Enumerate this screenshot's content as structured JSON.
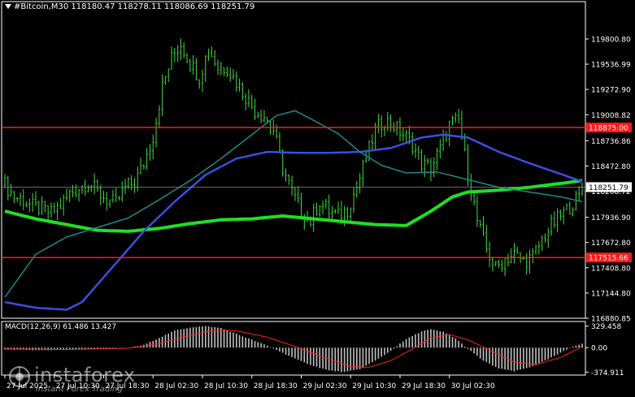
{
  "header": {
    "symbol_tf": "#Bitcoin,M30",
    "ohlc": "118180.47 118278.11 118086.69 118251.79"
  },
  "watermark": {
    "brand": "instaforex",
    "tagline": "Instant Forex Trading"
  },
  "chart_data": [
    {
      "type": "candlestick",
      "title": "#Bitcoin,M30",
      "ylim": [
        116880.85,
        120072
      ],
      "y_ticks": [
        119800.8,
        119536.99,
        119272.9,
        119008.82,
        118736.86,
        118472.8,
        118208.72,
        117936.9,
        117672.8,
        117408.8,
        117144.8,
        116880.85
      ],
      "x_ticks": [
        "27 Jul 2025",
        "27 Jul 10:30",
        "27 Jul 18:30",
        "28 Jul 02:30",
        "28 Jul 10:30",
        "28 Jul 18:30",
        "29 Jul 02:30",
        "29 Jul 10:30",
        "29 Jul 18:30",
        "30 Jul 02:30"
      ],
      "x_tick_bar_index": [
        0,
        16,
        32,
        48,
        64,
        80,
        96,
        112,
        128,
        144
      ],
      "last_price": 118251.79,
      "last_price_label": "118251.79",
      "close_points": [
        [
          0,
          118280
        ],
        [
          3,
          118150
        ],
        [
          6,
          118120
        ],
        [
          9,
          118050
        ],
        [
          12,
          118020
        ],
        [
          15,
          117980
        ],
        [
          18,
          118060
        ],
        [
          21,
          118180
        ],
        [
          24,
          118250
        ],
        [
          27,
          118300
        ],
        [
          30,
          118200
        ],
        [
          33,
          118120
        ],
        [
          36,
          118080
        ],
        [
          39,
          118250
        ],
        [
          42,
          118300
        ],
        [
          45,
          118500
        ],
        [
          48,
          118780
        ],
        [
          51,
          119300
        ],
        [
          54,
          119600
        ],
        [
          57,
          119750
        ],
        [
          60,
          119550
        ],
        [
          63,
          119400
        ],
        [
          66,
          119700
        ],
        [
          69,
          119500
        ],
        [
          72,
          119500
        ],
        [
          75,
          119350
        ],
        [
          78,
          119200
        ],
        [
          81,
          119050
        ],
        [
          84,
          119000
        ],
        [
          87,
          118850
        ],
        [
          90,
          118450
        ],
        [
          93,
          118200
        ],
        [
          96,
          118000
        ],
        [
          99,
          117900
        ],
        [
          102,
          118100
        ],
        [
          105,
          118000
        ],
        [
          108,
          117950
        ],
        [
          111,
          118020
        ],
        [
          114,
          118250
        ],
        [
          117,
          118550
        ],
        [
          120,
          118850
        ],
        [
          123,
          118950
        ],
        [
          126,
          118900
        ],
        [
          129,
          118800
        ],
        [
          132,
          118700
        ],
        [
          135,
          118500
        ],
        [
          138,
          118450
        ],
        [
          141,
          118650
        ],
        [
          144,
          118900
        ],
        [
          147,
          118950
        ],
        [
          150,
          118400
        ],
        [
          153,
          117900
        ],
        [
          156,
          117600
        ],
        [
          159,
          117400
        ],
        [
          162,
          117500
        ],
        [
          165,
          117550
        ],
        [
          168,
          117480
        ],
        [
          171,
          117520
        ],
        [
          174,
          117700
        ],
        [
          177,
          117850
        ],
        [
          180,
          117950
        ],
        [
          183,
          118050
        ],
        [
          186,
          118150
        ],
        [
          187,
          118251.79
        ]
      ],
      "bar_count": 188,
      "lines": [
        {
          "color": "#20e020",
          "width": 4,
          "points": [
            [
              0,
              118000
            ],
            [
              10,
              117920
            ],
            [
              20,
              117860
            ],
            [
              30,
              117800
            ],
            [
              40,
              117790
            ],
            [
              50,
              117820
            ],
            [
              60,
              117870
            ],
            [
              70,
              117910
            ],
            [
              80,
              117920
            ],
            [
              90,
              117950
            ],
            [
              100,
              117920
            ],
            [
              110,
              117890
            ],
            [
              120,
              117860
            ],
            [
              130,
              117850
            ],
            [
              138,
              118000
            ],
            [
              145,
              118150
            ],
            [
              150,
              118200
            ],
            [
              160,
              118220
            ],
            [
              170,
              118250
            ],
            [
              180,
              118290
            ],
            [
              187,
              118320
            ]
          ]
        },
        {
          "color": "#3a50e0",
          "width": 2.5,
          "points": [
            [
              0,
              117050
            ],
            [
              10,
              116990
            ],
            [
              20,
              116970
            ],
            [
              25,
              117050
            ],
            [
              35,
              117420
            ],
            [
              45,
              117790
            ],
            [
              55,
              118100
            ],
            [
              65,
              118380
            ],
            [
              75,
              118550
            ],
            [
              85,
              118620
            ],
            [
              95,
              118610
            ],
            [
              105,
              118610
            ],
            [
              115,
              118620
            ],
            [
              125,
              118660
            ],
            [
              135,
              118770
            ],
            [
              142,
              118800
            ],
            [
              150,
              118770
            ],
            [
              160,
              118620
            ],
            [
              170,
              118500
            ],
            [
              180,
              118390
            ],
            [
              187,
              118310
            ]
          ]
        },
        {
          "color": "#1d8a8a",
          "width": 1.5,
          "points": [
            [
              0,
              117100
            ],
            [
              10,
              117550
            ],
            [
              20,
              117730
            ],
            [
              30,
              117830
            ],
            [
              40,
              117930
            ],
            [
              50,
              118120
            ],
            [
              60,
              118320
            ],
            [
              70,
              118550
            ],
            [
              80,
              118800
            ],
            [
              88,
              119000
            ],
            [
              94,
              119050
            ],
            [
              100,
              118950
            ],
            [
              108,
              118810
            ],
            [
              115,
              118620
            ],
            [
              122,
              118480
            ],
            [
              130,
              118400
            ],
            [
              140,
              118410
            ],
            [
              150,
              118330
            ],
            [
              160,
              118250
            ],
            [
              170,
              118200
            ],
            [
              180,
              118150
            ],
            [
              187,
              118100
            ]
          ]
        }
      ],
      "levels": [
        {
          "value": 118875.0,
          "label": "118875.00",
          "color": "#ff1a1a"
        },
        {
          "value": 117515.66,
          "label": "117515.66",
          "color": "#ff1a1a"
        }
      ]
    },
    {
      "type": "bar",
      "title": "MACD(12,26,9)",
      "header": "MACD(12,26,9) 61.486 13.427",
      "macd_value": 61.486,
      "signal_value": 13.427,
      "ylim": [
        -420,
        400
      ],
      "y_ticks": [
        329.458,
        0.0,
        -374.911
      ],
      "y_tick_labels": [
        "329.458",
        "0.00",
        "-374.911"
      ],
      "histogram_points": [
        [
          0,
          -30
        ],
        [
          10,
          -40
        ],
        [
          20,
          -35
        ],
        [
          30,
          -25
        ],
        [
          40,
          0
        ],
        [
          45,
          40
        ],
        [
          50,
          150
        ],
        [
          55,
          260
        ],
        [
          60,
          310
        ],
        [
          65,
          329
        ],
        [
          70,
          300
        ],
        [
          75,
          210
        ],
        [
          80,
          120
        ],
        [
          85,
          30
        ],
        [
          90,
          -80
        ],
        [
          95,
          -190
        ],
        [
          100,
          -280
        ],
        [
          105,
          -350
        ],
        [
          110,
          -375
        ],
        [
          115,
          -330
        ],
        [
          120,
          -200
        ],
        [
          125,
          -50
        ],
        [
          130,
          130
        ],
        [
          135,
          250
        ],
        [
          138,
          280
        ],
        [
          142,
          240
        ],
        [
          146,
          140
        ],
        [
          150,
          -20
        ],
        [
          155,
          -200
        ],
        [
          160,
          -320
        ],
        [
          165,
          -360
        ],
        [
          170,
          -300
        ],
        [
          175,
          -200
        ],
        [
          180,
          -80
        ],
        [
          184,
          20
        ],
        [
          187,
          61
        ]
      ],
      "signal_points": [
        [
          0,
          -20
        ],
        [
          20,
          -30
        ],
        [
          40,
          -10
        ],
        [
          50,
          60
        ],
        [
          60,
          190
        ],
        [
          68,
          270
        ],
        [
          75,
          260
        ],
        [
          85,
          160
        ],
        [
          95,
          0
        ],
        [
          105,
          -180
        ],
        [
          112,
          -290
        ],
        [
          118,
          -300
        ],
        [
          125,
          -200
        ],
        [
          132,
          -20
        ],
        [
          138,
          150
        ],
        [
          144,
          200
        ],
        [
          150,
          120
        ],
        [
          158,
          -60
        ],
        [
          165,
          -220
        ],
        [
          172,
          -260
        ],
        [
          180,
          -150
        ],
        [
          187,
          13
        ]
      ],
      "signal_color": "#ff2020",
      "hist_color": "#c0c0c0"
    }
  ]
}
